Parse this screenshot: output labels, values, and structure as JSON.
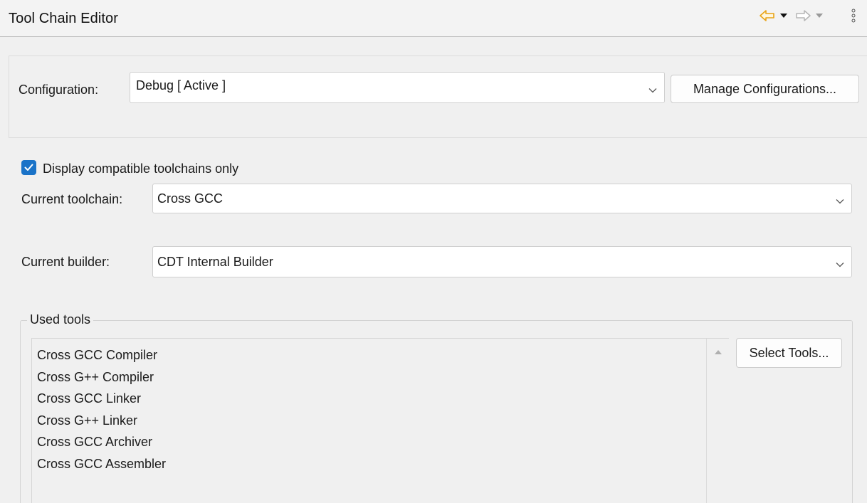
{
  "header": {
    "title": "Tool Chain Editor",
    "icons": [
      "back-arrow-icon",
      "dropdown-triangle-icon",
      "forward-arrow-icon",
      "dropdown-triangle-icon",
      "view-menu-icon"
    ],
    "back_color": "#e8a317",
    "disabled_color": "#b5b5b5"
  },
  "configuration": {
    "label": "Configuration:",
    "value": "Debug  [ Active ]",
    "manage_button": "Manage Configurations..."
  },
  "compatible_only": {
    "label": "Display compatible toolchains only",
    "checked": true,
    "accent": "#1a73c8"
  },
  "toolchain": {
    "label": "Current toolchain:",
    "value": "Cross GCC"
  },
  "builder": {
    "label": "Current builder:",
    "value": "CDT Internal Builder"
  },
  "used_tools": {
    "legend": "Used tools",
    "items": [
      "Cross GCC Compiler",
      "Cross G++ Compiler",
      "Cross GCC Linker",
      "Cross G++ Linker",
      "Cross GCC Archiver",
      "Cross GCC Assembler"
    ],
    "select_button": "Select Tools..."
  }
}
